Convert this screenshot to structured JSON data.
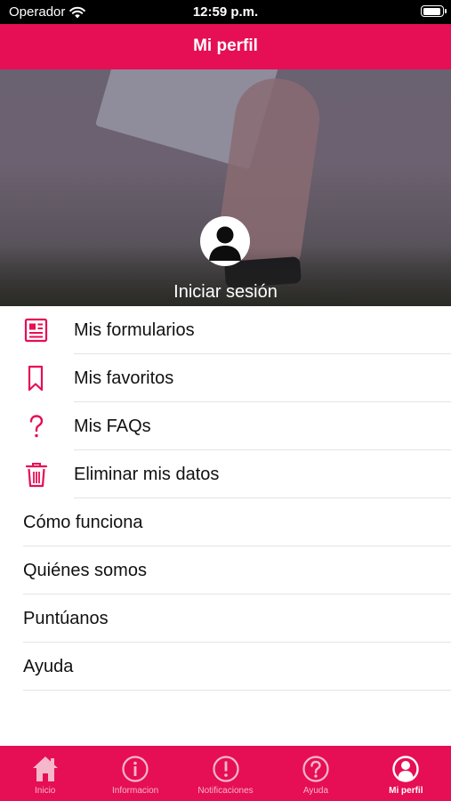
{
  "status_bar": {
    "carrier": "Operador",
    "time": "12:59 p.m."
  },
  "nav": {
    "title": "Mi perfil"
  },
  "hero": {
    "login_label": "Iniciar sesión"
  },
  "menu": {
    "icon_items": [
      {
        "label": "Mis formularios",
        "icon": "document-icon"
      },
      {
        "label": "Mis favoritos",
        "icon": "bookmark-icon"
      },
      {
        "label": "Mis FAQs",
        "icon": "question-mark-icon"
      },
      {
        "label": "Eliminar mis datos",
        "icon": "trash-icon"
      }
    ],
    "plain_items": [
      {
        "label": "Cómo funciona"
      },
      {
        "label": "Quiénes somos"
      },
      {
        "label": "Puntúanos"
      },
      {
        "label": "Ayuda"
      }
    ]
  },
  "tabs": [
    {
      "label": "Inicio",
      "icon": "home-icon"
    },
    {
      "label": "Informacion",
      "icon": "info-icon"
    },
    {
      "label": "Notificaciones",
      "icon": "alert-icon"
    },
    {
      "label": "Ayuda",
      "icon": "help-icon"
    },
    {
      "label": "Mi perfil",
      "icon": "profile-icon"
    }
  ],
  "colors": {
    "accent": "#e60e55",
    "tab_inactive": "#f4b7cb",
    "text": "#111111"
  }
}
